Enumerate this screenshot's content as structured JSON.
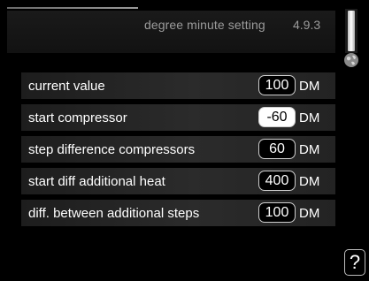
{
  "header": {
    "title": "degree minute setting",
    "menu_number": "4.9.3"
  },
  "rows": [
    {
      "label": "current value",
      "value": "100",
      "unit": "DM",
      "selected": false
    },
    {
      "label": "start compressor",
      "value": "-60",
      "unit": "DM",
      "selected": true
    },
    {
      "label": "step difference compressors",
      "value": "60",
      "unit": "DM",
      "selected": false
    },
    {
      "label": "start diff additional heat",
      "value": "400",
      "unit": "DM",
      "selected": false
    },
    {
      "label": "diff. between additional steps",
      "value": "100",
      "unit": "DM",
      "selected": false
    }
  ],
  "icons": {
    "globe": "globe-icon",
    "help": "?"
  },
  "colors": {
    "background": "#000000",
    "header_text": "#9b9b9b",
    "row_text": "#ffffff"
  }
}
